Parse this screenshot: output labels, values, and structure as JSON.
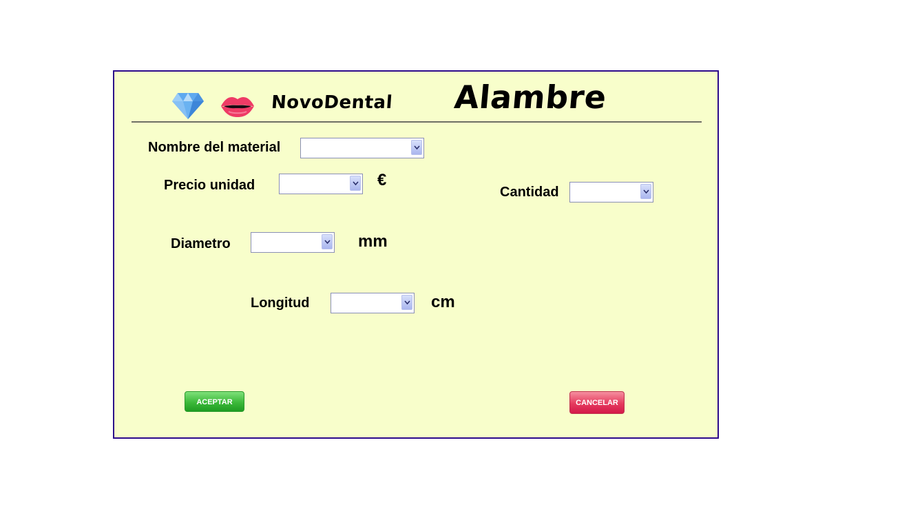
{
  "header": {
    "brand": "NovoDental",
    "title": "Alambre"
  },
  "icons": {
    "diamond": "diamond-icon",
    "lips": "lips-icon"
  },
  "form": {
    "material_label": "Nombre del material",
    "material_value": "",
    "precio_label": "Precio unidad",
    "precio_value": "",
    "precio_unit": "€",
    "cantidad_label": "Cantidad",
    "cantidad_value": "",
    "diametro_label": "Diametro",
    "diametro_value": "",
    "diametro_unit": "mm",
    "longitud_label": "Longitud",
    "longitud_value": "",
    "longitud_unit": "cm"
  },
  "buttons": {
    "accept_label": "ACEPTAR",
    "cancel_label": "CANCELAR"
  },
  "colors": {
    "panel_background": "#f8fecb",
    "panel_border": "#2c0a8a",
    "accept": "#3cb93a",
    "cancel": "#e53a5e"
  }
}
